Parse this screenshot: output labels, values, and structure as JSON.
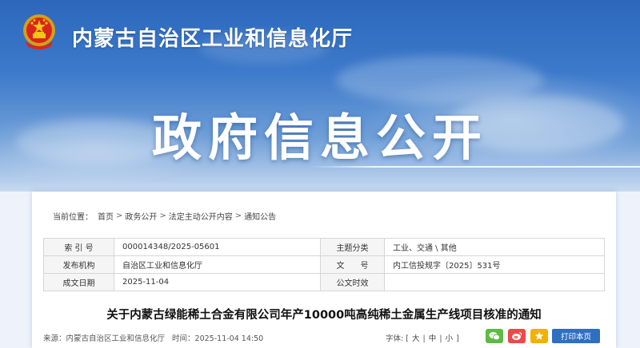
{
  "header": {
    "site_title": "内蒙古自治区工业和信息化厅",
    "section_title": "政府信息公开"
  },
  "breadcrumb": {
    "label": "当前位置：",
    "separator": ">",
    "items": [
      "首页",
      "政务公开",
      "法定主动公开内容",
      "通知公告"
    ]
  },
  "meta": {
    "rows": [
      {
        "k1": "索 引 号",
        "v1": "000014348/2025-05601",
        "k2": "主题分类",
        "v2": "工业、交通 \\ 其他"
      },
      {
        "k1": "发布机构",
        "v1": "自治区工业和信息化厅",
        "k2": "文　　号",
        "v2": "内工信投规字〔2025〕531号"
      },
      {
        "k1": "成文日期",
        "v1": "2025-11-04",
        "k2": "公文时效",
        "v2": ""
      }
    ]
  },
  "article": {
    "title": "关于内蒙古绿能稀土合金有限公司年产10000吨高纯稀土金属生产线项目核准的通知",
    "source": "来源：内蒙古自治区工业和信息化厅",
    "time": "时间：2025-11-04 14:50"
  },
  "tools": {
    "font_label": "字体:",
    "open": "[",
    "large": "大",
    "medium": "中",
    "small": "小",
    "close": "]",
    "divider": "|",
    "print_label": "打印本页",
    "share_icons": [
      "wechat-icon",
      "weibo-icon",
      "favorite-icon"
    ]
  },
  "colors": {
    "banner_top": "#2c67bb",
    "print_button": "#2f6fc2",
    "wechat": "#5dbb45",
    "weibo": "#e94a4a",
    "favorite": "#f2b100"
  }
}
